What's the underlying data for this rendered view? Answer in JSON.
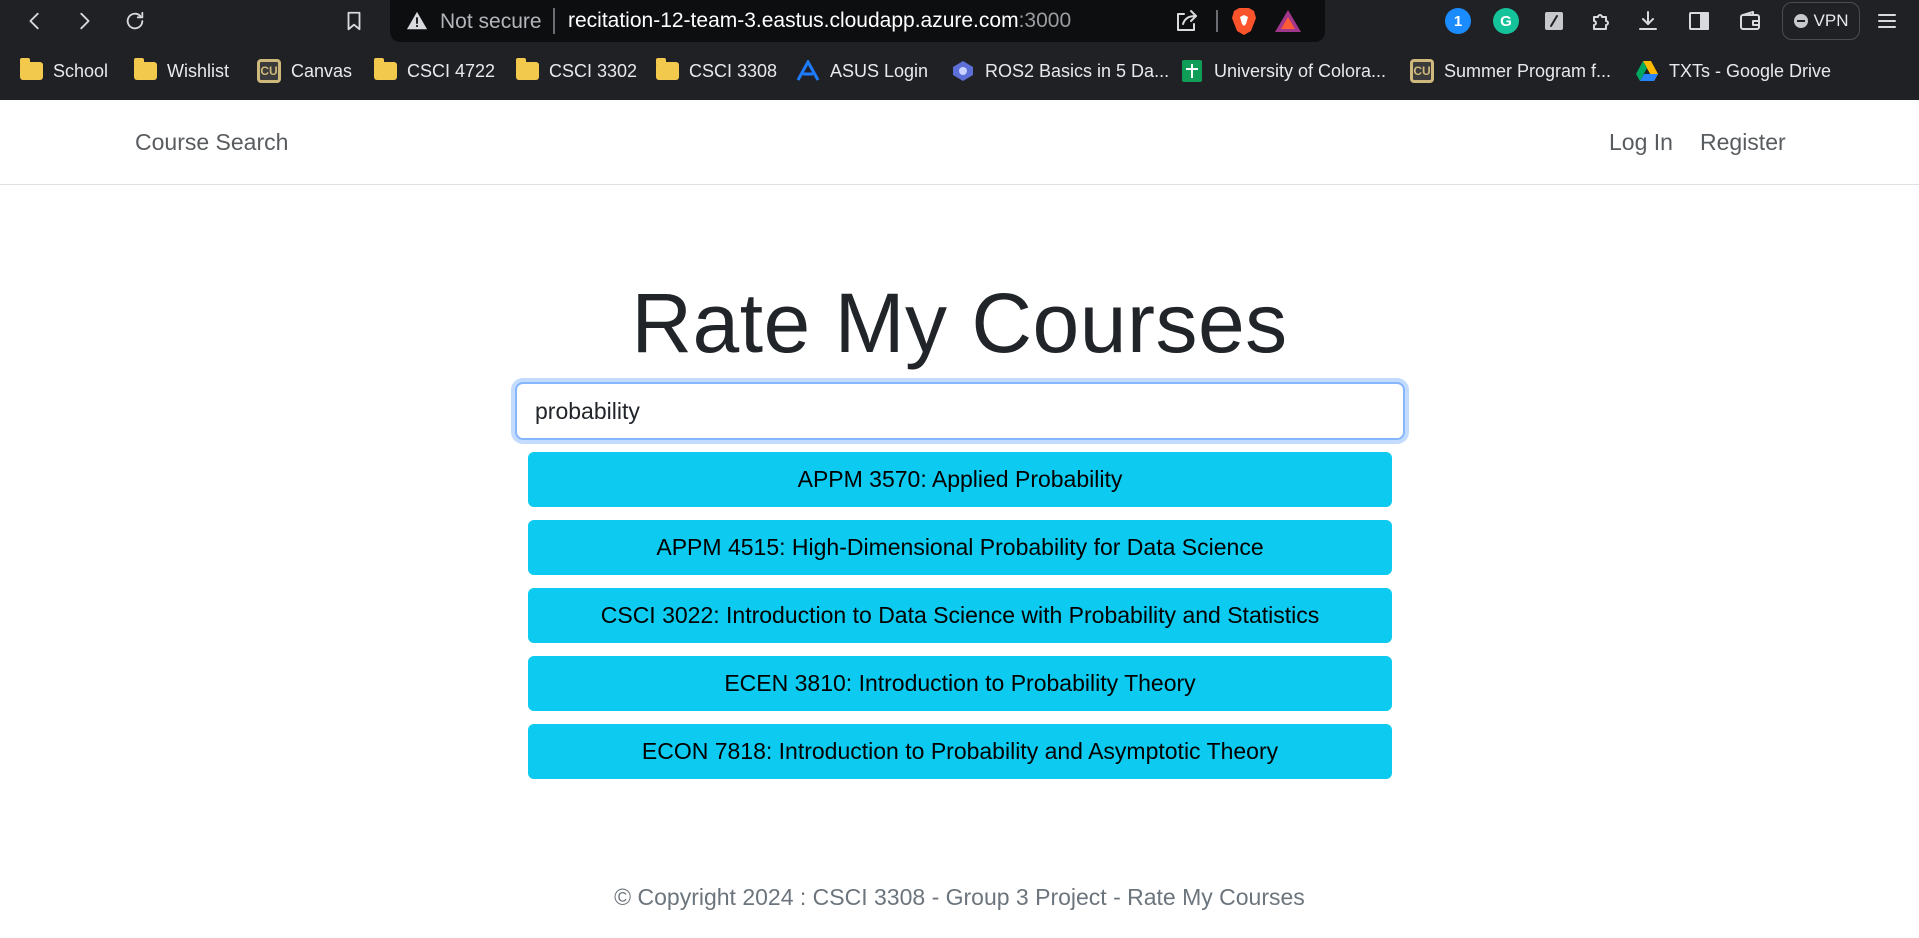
{
  "browser": {
    "security_label": "Not secure",
    "url_host": "recitation-12-team-3.eastus.cloudapp.azure.com",
    "url_port": ":3000",
    "vpn_label": "VPN",
    "bookmarks": [
      {
        "label": "School",
        "icon": "folder-icon"
      },
      {
        "label": "Wishlist",
        "icon": "folder-icon"
      },
      {
        "label": "Canvas",
        "icon": "cu-logo-icon"
      },
      {
        "label": "CSCI 4722",
        "icon": "folder-icon"
      },
      {
        "label": "CSCI 3302",
        "icon": "folder-icon"
      },
      {
        "label": "CSCI 3308",
        "icon": "folder-icon"
      },
      {
        "label": "ASUS Login",
        "icon": "asus-icon"
      },
      {
        "label": "ROS2 Basics in 5 Da...",
        "icon": "ros-icon"
      },
      {
        "label": "University of Colora...",
        "icon": "sheets-icon"
      },
      {
        "label": "Summer Program f...",
        "icon": "cu-logo-icon"
      },
      {
        "label": "TXTs - Google Drive",
        "icon": "drive-icon"
      }
    ],
    "more_glyph": "»"
  },
  "navbar": {
    "brand": "Course Search",
    "login": "Log In",
    "register": "Register"
  },
  "hero": {
    "title": "Rate My Courses"
  },
  "search": {
    "value": "probability"
  },
  "results": [
    "APPM 3570: Applied Probability",
    "APPM 4515: High-Dimensional Probability for Data Science",
    "CSCI 3022: Introduction to Data Science with Probability and Statistics",
    "ECEN 3810: Introduction to Probability Theory",
    "ECON 7818: Introduction to Probability and Asymptotic Theory"
  ],
  "footer": {
    "text": "© Copyright 2024 : CSCI 3308 - Group 3 Project - Rate My Courses"
  },
  "colors": {
    "accent_button": "#0dcaf0",
    "focus_border": "#86b7fe",
    "chrome_bg": "#202124"
  }
}
